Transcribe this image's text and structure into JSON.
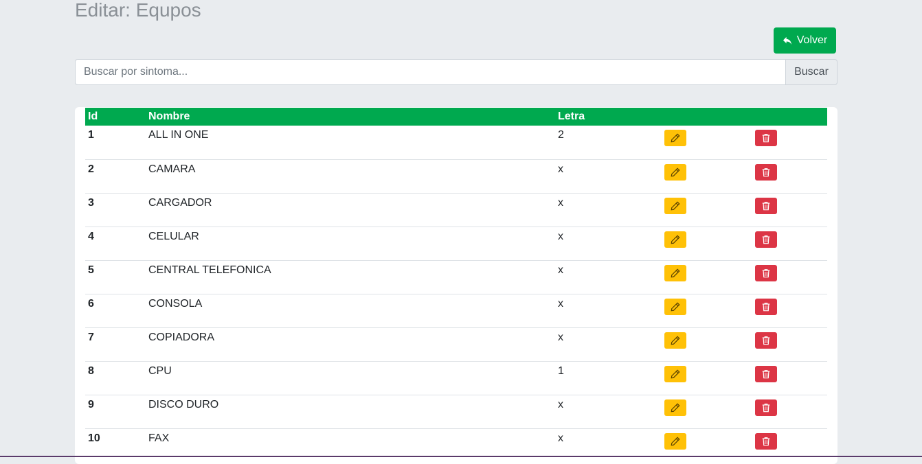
{
  "header": {
    "title": "Editar: Equpos"
  },
  "toolbar": {
    "back_label": "Volver"
  },
  "search": {
    "placeholder": "Buscar por sintoma...",
    "value": "",
    "button_label": "Buscar"
  },
  "table": {
    "columns": [
      "Id",
      "Nombre",
      "Letra"
    ],
    "rows": [
      {
        "id": "1",
        "nombre": "ALL IN ONE",
        "letra": "2"
      },
      {
        "id": "2",
        "nombre": "CAMARA",
        "letra": "x"
      },
      {
        "id": "3",
        "nombre": "CARGADOR",
        "letra": "x"
      },
      {
        "id": "4",
        "nombre": "CELULAR",
        "letra": "x"
      },
      {
        "id": "5",
        "nombre": "CENTRAL TELEFONICA",
        "letra": "x"
      },
      {
        "id": "6",
        "nombre": "CONSOLA",
        "letra": "x"
      },
      {
        "id": "7",
        "nombre": "COPIADORA",
        "letra": "x"
      },
      {
        "id": "8",
        "nombre": "CPU",
        "letra": "1"
      },
      {
        "id": "9",
        "nombre": "DISCO DURO",
        "letra": "x"
      },
      {
        "id": "10",
        "nombre": "FAX",
        "letra": "x"
      }
    ]
  },
  "icons": {
    "back": "reply-icon",
    "edit": "pencil-icon",
    "delete": "trash-icon"
  },
  "colors": {
    "primary": "#00a94f",
    "warning": "#ffc107",
    "danger": "#dc3545",
    "background": "#e9ecef"
  }
}
